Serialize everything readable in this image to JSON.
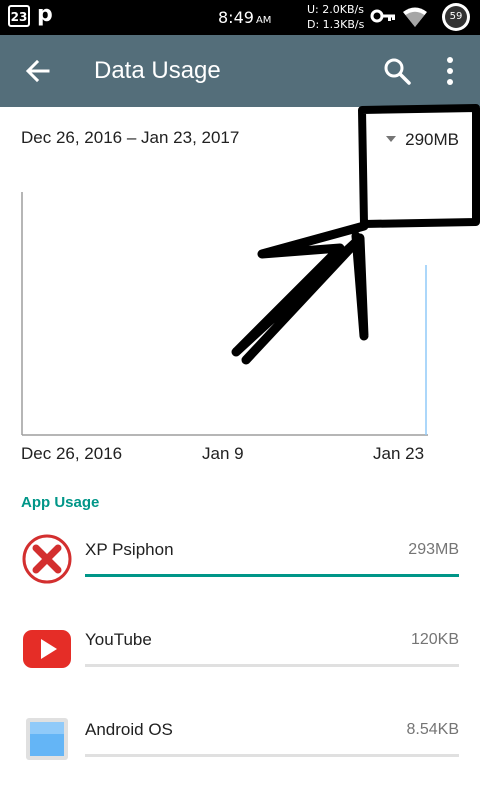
{
  "status_bar": {
    "calendar_day": "23",
    "app_letter": "p",
    "time": "8:49",
    "time_suffix": "AM",
    "upload": "U: 2.0KB/s",
    "download": "D: 1.3KB/s",
    "battery": "59"
  },
  "app_bar": {
    "title": "Data Usage",
    "back_icon": "arrow-back-icon",
    "search_icon": "search-icon",
    "menu_icon": "more-vert-icon"
  },
  "cycle": {
    "range": "Dec 26, 2016 – Jan 23, 2017",
    "total": "290MB"
  },
  "chart_data": {
    "type": "line",
    "x_labels": [
      "Dec 26, 2016",
      "Jan 9",
      "Jan 23"
    ],
    "x": [
      "Dec 26, 2016",
      "Jan 23, 2017"
    ],
    "series": [
      {
        "values": [
          0,
          290
        ]
      }
    ],
    "title": "",
    "xlabel": "",
    "ylabel": "",
    "grid": false
  },
  "section_title": "App Usage",
  "apps": [
    {
      "name": "XP Psiphon",
      "size": "293MB",
      "fraction": 1.0,
      "icon": "psiphon-icon"
    },
    {
      "name": "YouTube",
      "size": "120KB",
      "fraction": 0.0,
      "icon": "youtube-icon"
    },
    {
      "name": "Android OS",
      "size": "8.54KB",
      "fraction": 0.0,
      "icon": "android-os-icon"
    }
  ],
  "colors": {
    "app_bar": "#546e7a",
    "accent": "#009688",
    "status_bar": "#000000"
  }
}
